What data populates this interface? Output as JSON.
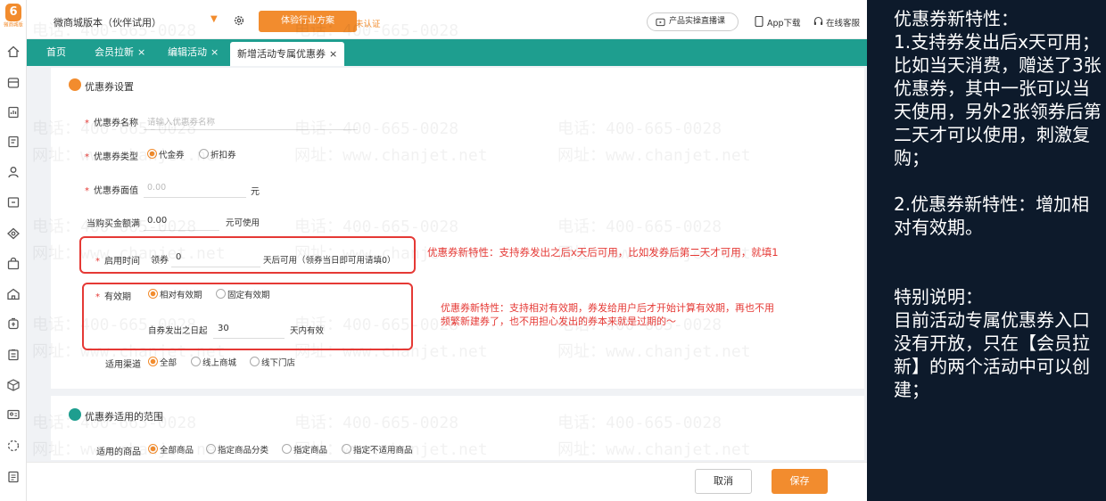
{
  "brand": {
    "logo_letter": "6",
    "logo_name": "微商城版"
  },
  "topbar": {
    "version_label": "微商城版本（伙伴试用）",
    "trial_button": "体验行业方案",
    "unverified": "未认证",
    "live_button": "产品实操直播课",
    "app_download": "App下载",
    "online_service": "在线客服"
  },
  "tabs": [
    {
      "label": "首页",
      "closable": false
    },
    {
      "label": "会员拉新",
      "closable": true
    },
    {
      "label": "编辑活动",
      "closable": true
    },
    {
      "label": "新增活动专属优惠券",
      "closable": true,
      "active": true
    }
  ],
  "tab_close_glyph": "×",
  "required_mark": "*",
  "coupon_settings": {
    "section_title": "优惠券设置",
    "name": {
      "label": "优惠券名称",
      "placeholder": "请输入优惠券名称"
    },
    "type": {
      "label": "优惠券类型",
      "options": [
        "代金券",
        "折扣券"
      ],
      "selected": "代金券"
    },
    "face_value": {
      "label": "优惠券面值",
      "placeholder": "0.00",
      "unit": "元"
    },
    "threshold": {
      "label": "当购买金额满",
      "value": "0.00",
      "suffix": "元可使用"
    },
    "start_time": {
      "label": "启用时间",
      "prefix": "领券",
      "value": "0",
      "suffix": "天后可用（领券当日即可用请填0）"
    },
    "validity": {
      "label": "有效期",
      "options": [
        "相对有效期",
        "固定有效期"
      ],
      "selected": "相对有效期",
      "prefix": "自券发出之日起",
      "value": "30",
      "suffix": "天内有效"
    },
    "channel": {
      "label": "适用渠道",
      "options": [
        "全部",
        "线上商城",
        "线下门店"
      ],
      "selected": "全部"
    }
  },
  "scope": {
    "section_title": "优惠券适用的范围",
    "goods": {
      "label": "适用的商品",
      "options": [
        "全部商品",
        "指定商品分类",
        "指定商品",
        "指定不适用商品"
      ],
      "selected": "全部商品"
    }
  },
  "annotations": {
    "start_time_note": "优惠券新特性：支持券发出之后x天后可用，比如发券后第二天才可用，就填1",
    "validity_note_line1": "优惠券新特性：支持相对有效期，券发给用户后才开始计算有效期，再也不用",
    "validity_note_line2": "频繁新建券了，也不用担心发出的券本来就是过期的～"
  },
  "footer": {
    "cancel": "取消",
    "save": "保存"
  },
  "watermark": {
    "phone": "电话：400-665-0028",
    "site": "网址：www.chanjet.net"
  },
  "side_panel": {
    "text": "优惠券新特性：\n1.支持券发出后x天可用；比如当天消费，赠送了3张优惠券，其中一张可以当天使用，另外2张领券后第二天才可以使用，刺激复购；\n\n2.优惠券新特性：增加相对有效期。\n\n\n特别说明：\n目前活动专属优惠券入口没有开放，只在【会员拉新】的两个活动中可以创建；"
  },
  "colors": {
    "accent": "#f28c2e",
    "tab_bar": "#1e9e8f",
    "annotation": "#e53935",
    "panel_bg": "#0d1a2b"
  }
}
